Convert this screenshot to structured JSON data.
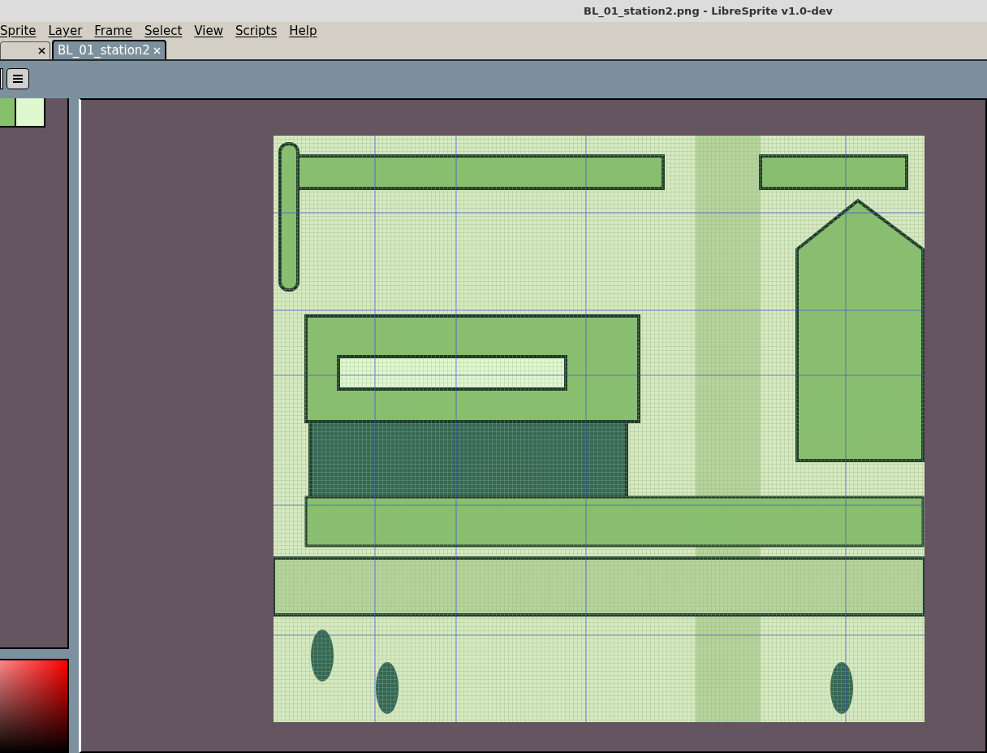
{
  "window": {
    "title": "BL_01_station2.png - LibreSprite v1.0-dev"
  },
  "menu": [
    "Sprite",
    "Layer",
    "Frame",
    "Select",
    "View",
    "Scripts",
    "Help"
  ],
  "tabs": [
    {
      "selected": false
    },
    {
      "label": "BL_01_station2",
      "selected": true
    }
  ],
  "palette": [
    {
      "color": "#86c06c"
    },
    {
      "color": "#e0f8cf"
    }
  ]
}
